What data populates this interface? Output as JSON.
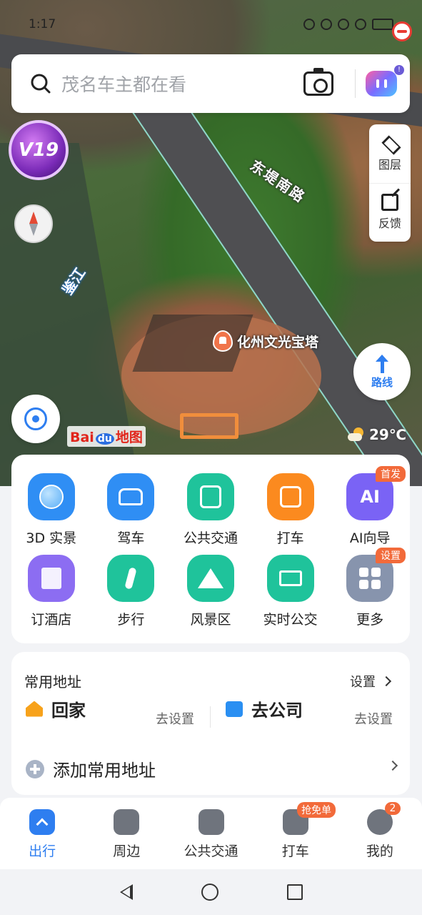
{
  "status": {
    "time": "1:17"
  },
  "search": {
    "placeholder": "茂名车主都在看"
  },
  "map": {
    "badge": "V19",
    "side_panel": {
      "layers": "图层",
      "feedback": "反馈"
    },
    "road_label": "东堤南路",
    "river_label": "鉴江",
    "poi_label": "化州文光宝塔",
    "route_label": "路线",
    "logo_bai": "Bai",
    "logo_du": "du",
    "logo_map": "地图",
    "weather": "29℃"
  },
  "quick_actions": [
    {
      "label": "3D 实景",
      "icon": "globe-icon",
      "color": "#2f8ef4"
    },
    {
      "label": "驾车",
      "icon": "car-icon",
      "color": "#2f8ef4"
    },
    {
      "label": "公共交通",
      "icon": "bus-icon",
      "color": "#1fc39b"
    },
    {
      "label": "打车",
      "icon": "taxi-icon",
      "color": "#fb8a1f"
    },
    {
      "label": "AI向导",
      "icon": "ai-icon",
      "color": "#7a63f5",
      "badge": "首发",
      "text": "AI"
    },
    {
      "label": "订酒店",
      "icon": "hotel-icon",
      "color": "#8c6df2"
    },
    {
      "label": "步行",
      "icon": "walk-icon",
      "color": "#1fc39b"
    },
    {
      "label": "风景区",
      "icon": "scenic-icon",
      "color": "#1fc39b"
    },
    {
      "label": "实时公交",
      "icon": "bus-stop-icon",
      "color": "#1fc39b"
    },
    {
      "label": "更多",
      "icon": "more-grid-icon",
      "color": "#8794ad",
      "badge": "设置"
    }
  ],
  "addresses": {
    "title": "常用地址",
    "setting": "设置",
    "home": {
      "label": "回家",
      "action": "去设置"
    },
    "work": {
      "label": "去公司",
      "action": "去设置"
    },
    "add_label": "添加常用地址"
  },
  "bottom_nav": [
    {
      "label": "出行",
      "active": true
    },
    {
      "label": "周边"
    },
    {
      "label": "公共交通"
    },
    {
      "label": "打车",
      "badge": "抢免单"
    },
    {
      "label": "我的",
      "badge": "2"
    }
  ],
  "colors": {
    "accent": "#2e7ef0",
    "badge": "#f26a3a"
  }
}
